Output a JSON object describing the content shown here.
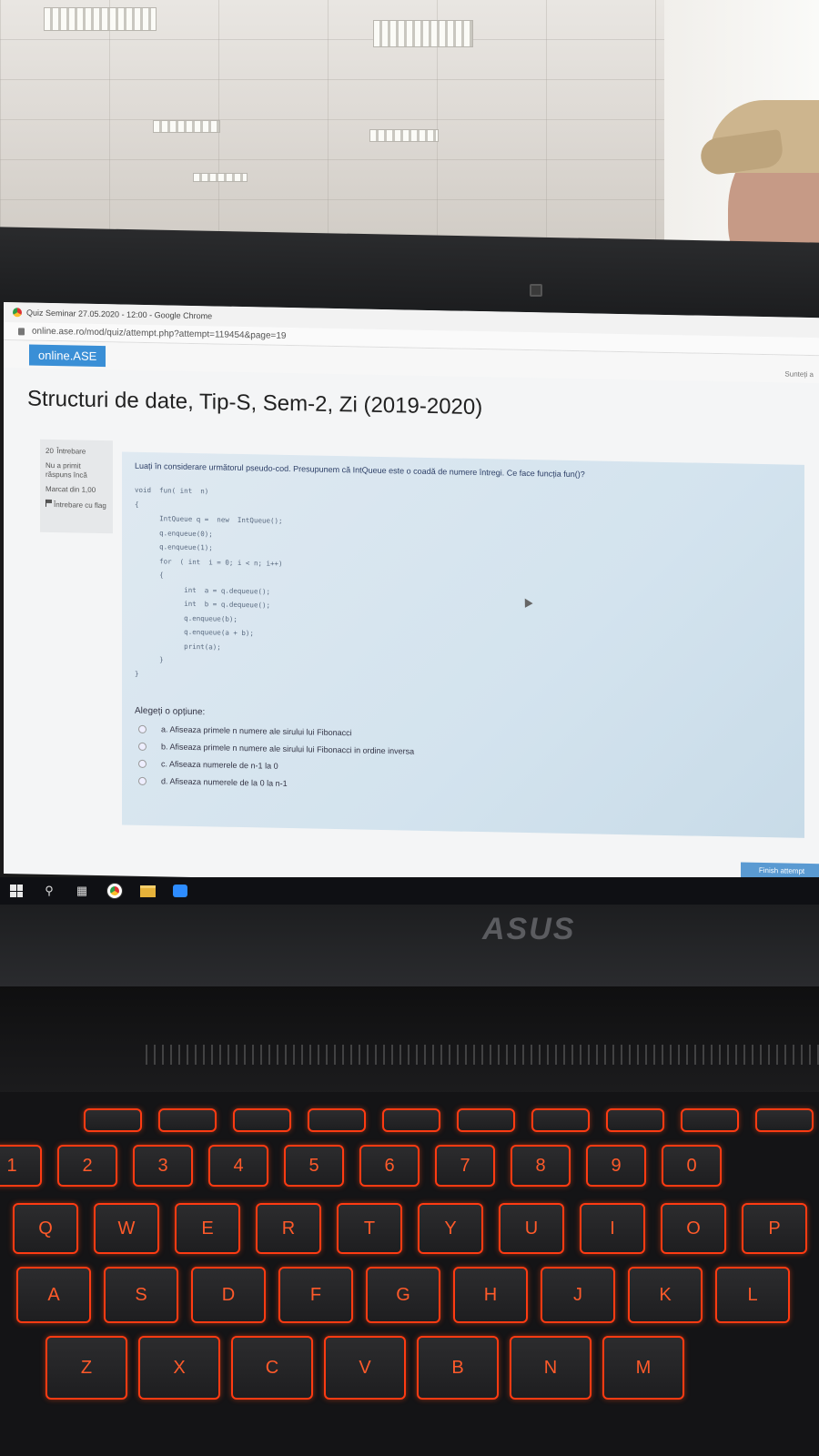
{
  "window": {
    "title": "Quiz Seminar 27.05.2020 - 12:00 - Google Chrome",
    "url": "online.ase.ro/mod/quiz/attempt.php?attempt=119454&page=19"
  },
  "site": {
    "brand": "online.ASE",
    "user_link": "Sunteți a"
  },
  "course": {
    "title": "Structuri de date, Tip-S, Sem-2, Zi (2019-2020)"
  },
  "question_info": {
    "number": "20",
    "number_label": "Întrebare",
    "status": "Nu a primit răspuns încă",
    "marks": "Marcat din 1,00",
    "flag_label": "Întrebare cu flag"
  },
  "question": {
    "text": "Luați în considerare următorul pseudo-cod. Presupunem că IntQueue este o coadă de numere întregi. Ce face funcția fun()?",
    "code_lines": [
      "void  fun( int  n)",
      "{",
      "      IntQueue q =  new  IntQueue();",
      "      q.enqueue(0);",
      "      q.enqueue(1);",
      "      for  ( int  i = 0; i < n; i++)",
      "      {",
      "            int  a = q.dequeue();",
      "            int  b = q.dequeue();",
      "            q.enqueue(b);",
      "            q.enqueue(a + b);",
      "            print(a);",
      "      }",
      "}"
    ],
    "options_label": "Alegeți o opțiune:",
    "options": [
      "a. Afiseaza primele n numere ale sirului lui Fibonacci",
      "b. Afiseaza primele n numere ale sirului lui Fibonacci in ordine inversa",
      "c. Afiseaza numerele de n-1 la 0",
      "d. Afiseaza numerele de la 0 la n-1"
    ]
  },
  "navigation": {
    "finish_label": "Finish attempt"
  },
  "taskbar": {
    "icons": [
      "windows-start-icon",
      "search-icon",
      "task-view-icon",
      "chrome-icon",
      "file-explorer-icon",
      "zoom-icon"
    ]
  },
  "laptop": {
    "brand": "ASUS"
  },
  "keyboard": {
    "number_row": [
      "1",
      "2",
      "3",
      "4",
      "5",
      "6",
      "7",
      "8",
      "9",
      "0"
    ],
    "top_row": [
      "Q",
      "W",
      "E",
      "R",
      "T",
      "Y",
      "U",
      "I",
      "O",
      "P"
    ],
    "home_row": [
      "A",
      "S",
      "D",
      "F",
      "G",
      "H",
      "J",
      "K",
      "L"
    ],
    "bottom_row": [
      "Z",
      "X",
      "C",
      "V",
      "B",
      "N",
      "M"
    ]
  },
  "colors": {
    "accent": "#3a8fd6",
    "key_backlight": "#ff3b12",
    "question_panel": "#d3e3ee"
  }
}
